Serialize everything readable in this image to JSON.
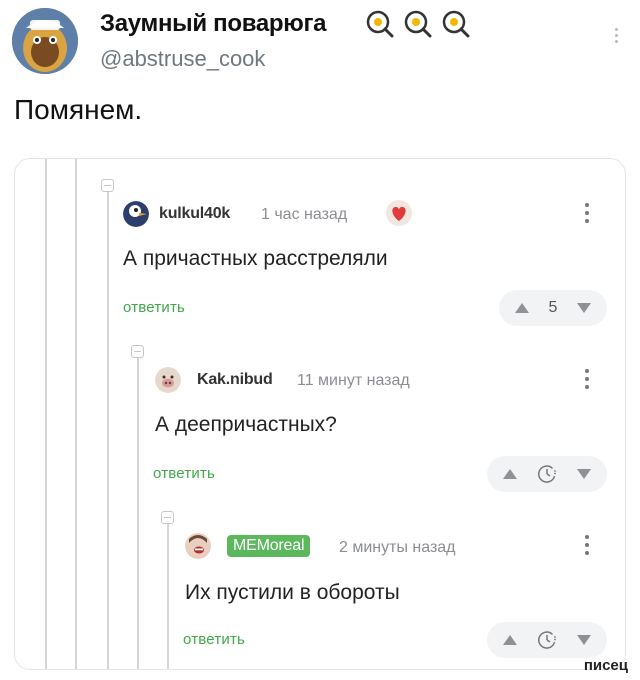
{
  "tweet": {
    "author_name": "Заумный поварюга",
    "author_handle": "@abstruse_cook",
    "text": "Помянем.",
    "emoji_icons": [
      "fried-egg-icon",
      "fried-egg-icon",
      "fried-egg-icon"
    ]
  },
  "thread": {
    "comments": [
      {
        "username": "kulkul40k",
        "time": "1 час назад",
        "text": "А причастных расстреляли",
        "reply_label": "ответить",
        "rating": "5"
      },
      {
        "username": "Kak.nibud",
        "time": "11 минут назад",
        "text": "А деепричастных?",
        "reply_label": "ответить",
        "rating": ""
      },
      {
        "username": "MEMoreal",
        "time": "2 минуты назад",
        "text": "Их пустили в обороты",
        "reply_label": "ответить",
        "rating": ""
      }
    ]
  },
  "watermark": "писец",
  "colors": {
    "reply_green": "#3fa94a",
    "badge_green": "#5cb85c",
    "handle_gray": "#6f7780"
  }
}
